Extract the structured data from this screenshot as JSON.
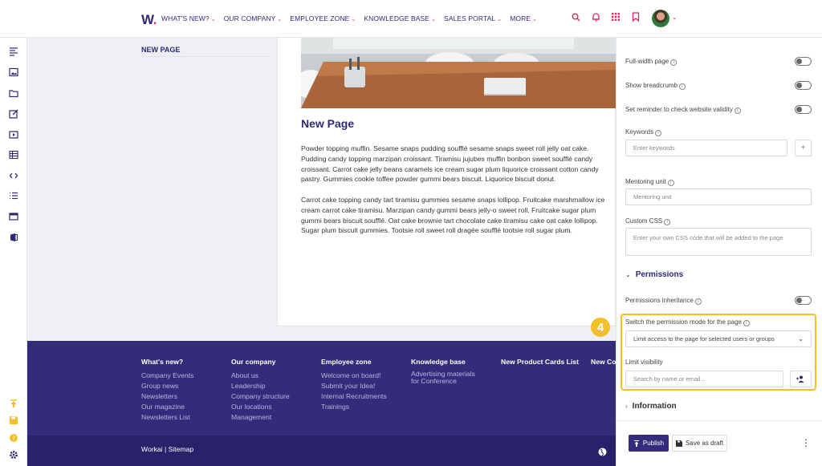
{
  "header": {
    "logo": "W",
    "nav": [
      {
        "label": "WHAT'S NEW?"
      },
      {
        "label": "OUR COMPANY"
      },
      {
        "label": "EMPLOYEE ZONE"
      },
      {
        "label": "KNOWLEDGE BASE"
      },
      {
        "label": "SALES PORTAL"
      },
      {
        "label": "MORE"
      }
    ],
    "icons": [
      "search-icon",
      "bell-icon",
      "apps-grid-icon",
      "bookmark-icon"
    ],
    "accent_color": "#e2295d",
    "brand_color": "#2d2a78"
  },
  "left_rail": {
    "icons": [
      "article-icon",
      "image-icon",
      "folder-icon",
      "edit-icon",
      "video-icon",
      "table-icon",
      "code-icon",
      "list-icon",
      "card-icon",
      "office-icon"
    ],
    "bottom_icons": [
      "publish-icon",
      "save-icon",
      "help-icon",
      "settings-icon"
    ]
  },
  "content": {
    "nav_label": "NEW PAGE",
    "title": "New Page",
    "paragraphs": [
      "Powder topping muffin. Sesame snaps pudding soufflé sesame snaps sweet roll jelly oat cake. Pudding candy topping marzipan croissant. Tiramisu jujubes muffin bonbon sweet soufflé candy croissant. Carrot cake jelly beans caramels ice cream sugar plum liquorice croissant cotton candy pastry. Gummies cookie toffee powder gummi bears biscuit. Liquorice biscuit donut.",
      "Carrot cake topping candy tart tiramisu gummies sesame snaps lollipop. Fruitcake marshmallow ice cream carrot cake tiramisu. Marzipan candy gummi bears jelly-o sweet roll. Fruitcake sugar plum gummi bears biscuit soufflé. Oat cake brownie tart chocolate cake tiramisu cake oat cake lollipop. Sugar plum biscuit gummies. Tootsie roll sweet roll dragée soufflé tootsie roll sugar plum."
    ]
  },
  "footer": {
    "columns": [
      {
        "heading": "What's new?",
        "links": [
          "Company Events",
          "Group news",
          "Newsletters",
          "Our magazine",
          "Newsletters List"
        ]
      },
      {
        "heading": "Our company",
        "links": [
          "About us",
          "Leadership",
          "Company structure",
          "Our locations",
          "Management"
        ]
      },
      {
        "heading": "Employee zone",
        "links": [
          "Welcome on board!",
          "Submit your Idea!",
          "Internal Recruitments",
          "Trainings"
        ]
      },
      {
        "heading": "Knowledge base",
        "links": [
          "Advertising materials",
          "for Conference"
        ]
      },
      {
        "heading": "New Product Cards List",
        "links": []
      },
      {
        "heading": "New Co",
        "links": []
      }
    ],
    "brand": "Workai | Sitemap"
  },
  "panel": {
    "full_width": "Full-width page",
    "show_breadcrumb": "Show breadcrumb",
    "reminder": "Set reminder to check website validity",
    "keywords_label": "Keywords",
    "keywords_placeholder": "Enter keywords",
    "plus": "+",
    "mentoring_label": "Mentoring unit",
    "mentoring_placeholder": "Mentoring unit",
    "css_label": "Custom CSS",
    "css_placeholder": "Enter your own CSS code that will be added to the page",
    "permissions_heading": "Permissions",
    "permissions_inheritance": "Permissions inheritance",
    "step_number": "4",
    "switch_mode_label": "Switch the permission mode for the page",
    "switch_mode_value": "Limit access to the page for selected users or groups",
    "limit_visibility_label": "Limit visibility",
    "search_placeholder": "Search by name or email...",
    "information_heading": "Information",
    "publish": "Publish",
    "save_draft": "Save as draft",
    "highlight_color": "#f3c02a"
  }
}
